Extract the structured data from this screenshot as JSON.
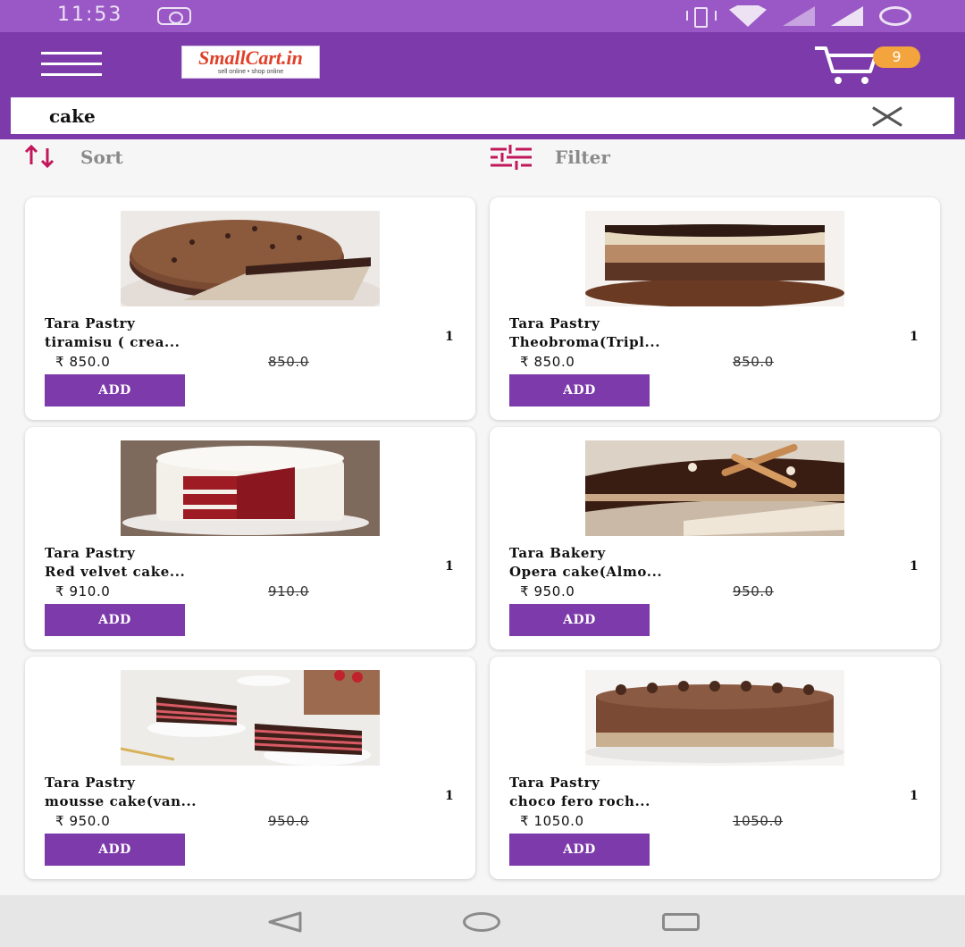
{
  "status": {
    "time": "11:53"
  },
  "header": {
    "logo_main": "SmallCart.in",
    "logo_sub": "sell online • shop online",
    "cart_count": "9"
  },
  "search": {
    "value": "cake"
  },
  "toolbar": {
    "sort_label": "Sort",
    "filter_label": "Filter"
  },
  "products": [
    {
      "brand": "Tara Pastry",
      "name": "tiramisu ( crea...",
      "qty": "1",
      "price": "₹ 850.0",
      "mrp": "850.0",
      "add_label": "ADD",
      "image": "tiramisu-cake"
    },
    {
      "brand": "Tara Pastry",
      "name": "Theobroma(Tripl...",
      "qty": "1",
      "price": "₹ 850.0",
      "mrp": "850.0",
      "add_label": "ADD",
      "image": "triple-layer-mousse-cake"
    },
    {
      "brand": "Tara Pastry",
      "name": "Red velvet cake...",
      "qty": "1",
      "price": "₹ 910.0",
      "mrp": "910.0",
      "add_label": "ADD",
      "image": "red-velvet-cake"
    },
    {
      "brand": "Tara Bakery",
      "name": "Opera cake(Almo...",
      "qty": "1",
      "price": "₹ 950.0",
      "mrp": "950.0",
      "add_label": "ADD",
      "image": "opera-cake"
    },
    {
      "brand": "Tara Pastry",
      "name": "mousse cake(van...",
      "qty": "1",
      "price": "₹ 950.0",
      "mrp": "950.0",
      "add_label": "ADD",
      "image": "mousse-cake-slices"
    },
    {
      "brand": "Tara Pastry",
      "name": "choco fero roch...",
      "qty": "1",
      "price": "₹ 1050.0",
      "mrp": "1050.0",
      "add_label": "ADD",
      "image": "chocolate-ferrero-cake"
    }
  ]
}
